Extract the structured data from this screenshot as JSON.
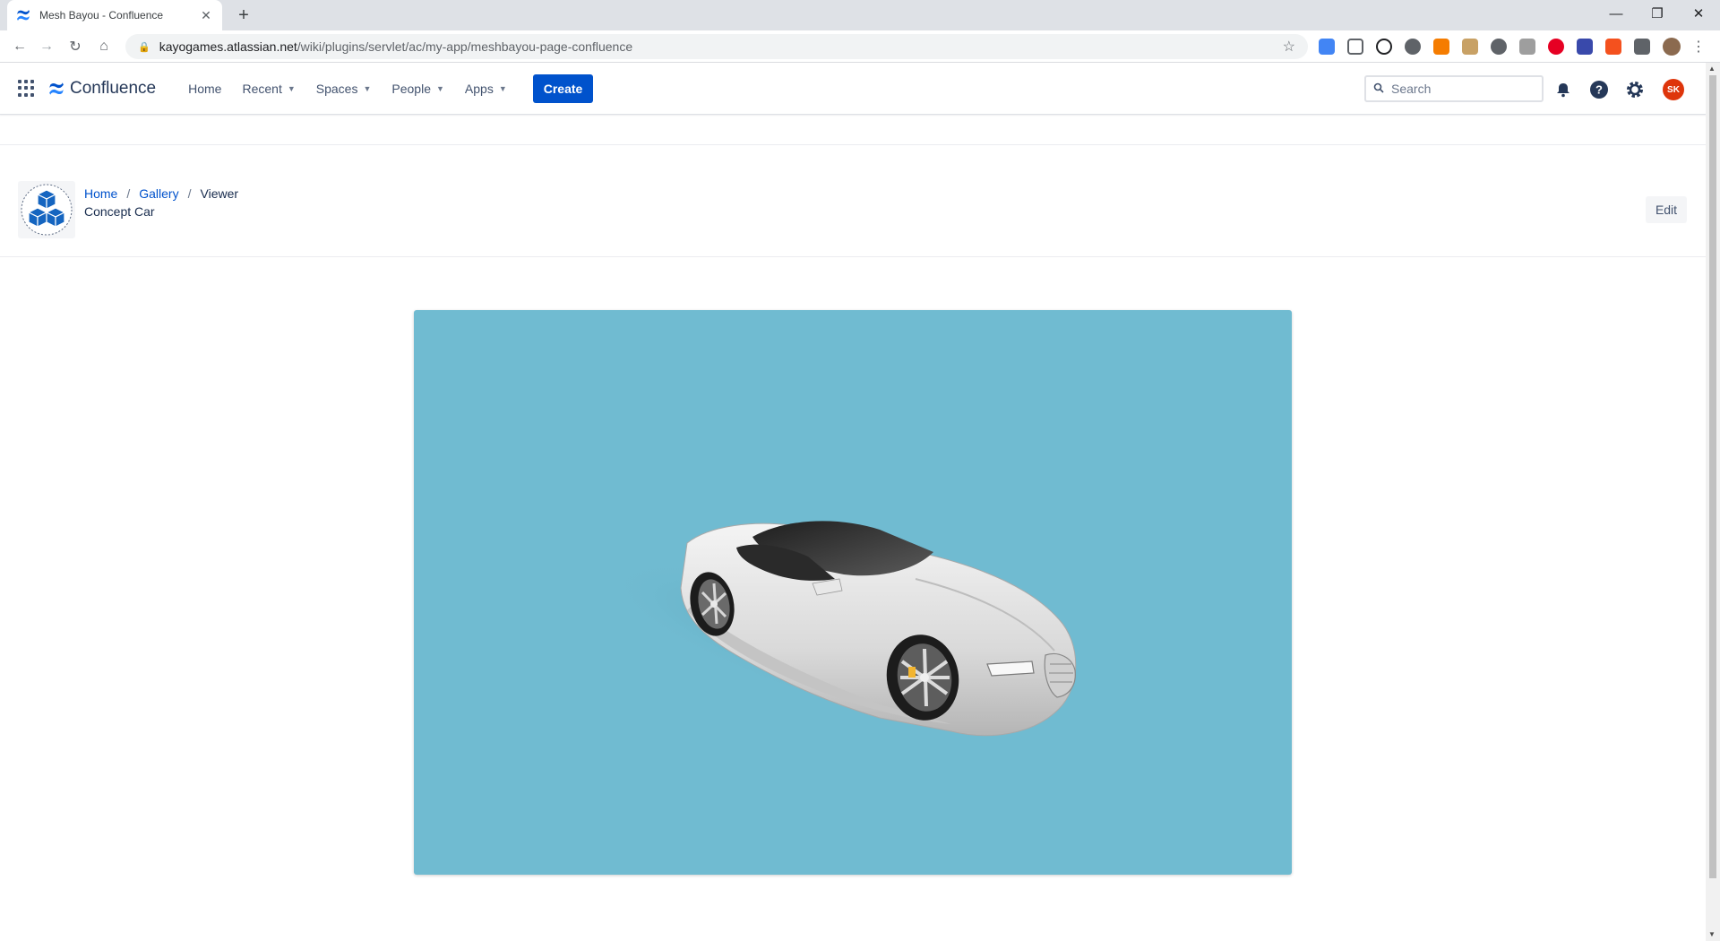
{
  "browser": {
    "tab_title": "Mesh Bayou - Confluence",
    "url_host": "kayogames.atlassian.net",
    "url_path": "/wiki/plugins/servlet/ac/my-app/meshbayou-page-confluence"
  },
  "header": {
    "product": "Confluence",
    "nav": {
      "home": "Home",
      "recent": "Recent",
      "spaces": "Spaces",
      "people": "People",
      "apps": "Apps"
    },
    "create_label": "Create",
    "search_placeholder": "Search",
    "user_initials": "SK"
  },
  "page": {
    "breadcrumbs": [
      "Home",
      "Gallery",
      "Viewer"
    ],
    "title": "Concept Car",
    "edit_label": "Edit"
  },
  "colors": {
    "viewer_background": "#70bbd1",
    "primary": "#0052cc",
    "avatar": "#de350b"
  }
}
